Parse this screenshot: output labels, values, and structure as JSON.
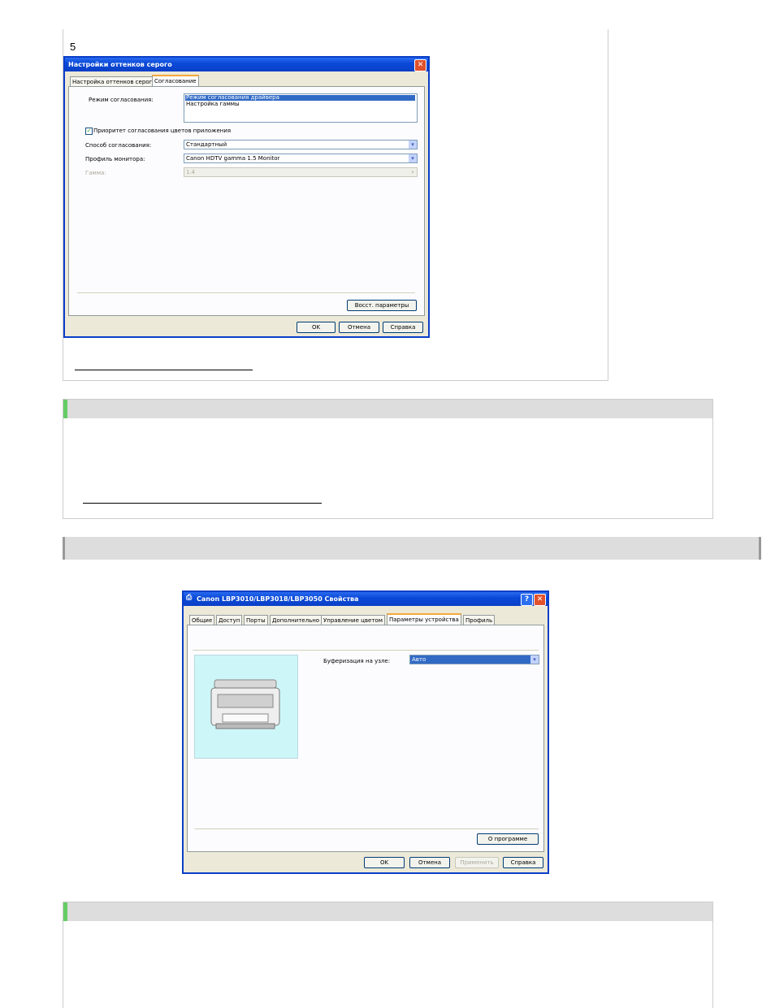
{
  "step": {
    "number": "5"
  },
  "dialog1": {
    "title": "Настройки оттенков серого",
    "tabs": [
      "Настройка оттенков серого",
      "Согласование"
    ],
    "matching_mode_label": "Режим согласования:",
    "matching_mode_options": [
      "Режим согласования драйвера",
      "Настройка гаммы"
    ],
    "priority_checkbox_label": "Приоритет согласования цветов приложения",
    "priority_checked": true,
    "method_label": "Способ согласования:",
    "method_value": "Стандартный",
    "monitor_profile_label": "Профиль монитора:",
    "monitor_profile_value": "Canon HDTV gamma 1.5 Monitor",
    "gamma_label": "Гамма:",
    "gamma_value": "1.4",
    "restore_button": "Восст. параметры",
    "ok_button": "OK",
    "cancel_button": "Отмена",
    "help_button": "Справка"
  },
  "dialog2": {
    "title": "Canon LBP3010/LBP3018/LBP3050 Свойства",
    "tabs": [
      "Общие",
      "Доступ",
      "Порты",
      "Дополнительно",
      "Управление цветом",
      "Параметры устройства",
      "Профиль"
    ],
    "spooling_label": "Буферизация на узле:",
    "spooling_value": "Авто",
    "about_button": "О программе",
    "ok_button": "OK",
    "cancel_button": "Отмена",
    "apply_button": "Применить",
    "help_button": "Справка"
  },
  "colors": {
    "xp_blue": "#0a4ad8",
    "note_green": "#66cc66",
    "preview_bg": "#cdf6f8"
  }
}
